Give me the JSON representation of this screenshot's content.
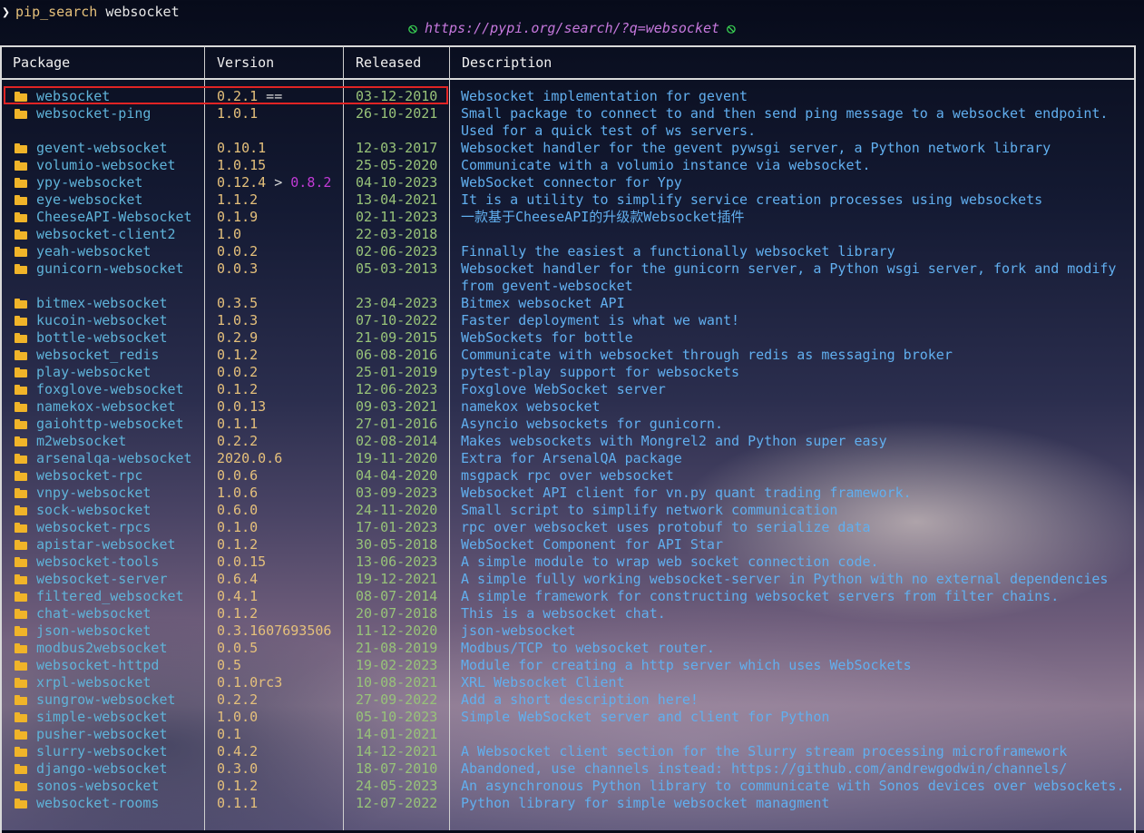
{
  "prompt": {
    "caret": "❯",
    "command": "pip_search",
    "argument": "websocket"
  },
  "url_line": {
    "icon": "⦸",
    "url": "https://pypi.org/search/?q=websocket"
  },
  "columns": [
    "Package",
    "Version",
    "Released",
    "Description"
  ],
  "colors": {
    "package": "#5fb3d9",
    "version": "#e5c07b",
    "date": "#98c379",
    "description": "#61afef",
    "folder_icon": "#f0b429",
    "highlight": "#e02424"
  },
  "rows": [
    {
      "pkg": "websocket",
      "ver": "0.2.1",
      "ver_cmp": " ==",
      "ver_new": "",
      "date": "03-12-2010",
      "desc": "Websocket implementation for gevent"
    },
    {
      "pkg": "websocket-ping",
      "ver": "1.0.1",
      "ver_cmp": "",
      "ver_new": "",
      "date": "26-10-2021",
      "desc": "Small package to connect to and then send ping message to a websocket endpoint."
    },
    {
      "pkg": "",
      "ver": "",
      "ver_cmp": "",
      "ver_new": "",
      "date": "",
      "desc": "Used for a quick test of ws servers."
    },
    {
      "pkg": "gevent-websocket",
      "ver": "0.10.1",
      "ver_cmp": "",
      "ver_new": "",
      "date": "12-03-2017",
      "desc": "Websocket handler for the gevent pywsgi server, a Python network library"
    },
    {
      "pkg": "volumio-websocket",
      "ver": "1.0.15",
      "ver_cmp": "",
      "ver_new": "",
      "date": "25-05-2020",
      "desc": "Communicate with a volumio instance via websocket."
    },
    {
      "pkg": "ypy-websocket",
      "ver": "0.12.4",
      "ver_cmp": " > ",
      "ver_new": "0.8.2",
      "date": "04-10-2023",
      "desc": "WebSocket connector for Ypy"
    },
    {
      "pkg": "eye-websocket",
      "ver": "1.1.2",
      "ver_cmp": "",
      "ver_new": "",
      "date": "13-04-2021",
      "desc": "It is a utility to simplify service creation processes using websockets"
    },
    {
      "pkg": "CheeseAPI-Websocket",
      "ver": "0.1.9",
      "ver_cmp": "",
      "ver_new": "",
      "date": "02-11-2023",
      "desc": "一款基于CheeseAPI的升级款Websocket插件"
    },
    {
      "pkg": "websocket-client2",
      "ver": "1.0",
      "ver_cmp": "",
      "ver_new": "",
      "date": "22-03-2018",
      "desc": ""
    },
    {
      "pkg": "yeah-websocket",
      "ver": "0.0.2",
      "ver_cmp": "",
      "ver_new": "",
      "date": "02-06-2023",
      "desc": "Finnally the easiest a functionally websocket library"
    },
    {
      "pkg": "gunicorn-websocket",
      "ver": "0.0.3",
      "ver_cmp": "",
      "ver_new": "",
      "date": "05-03-2013",
      "desc": "Websocket handler for the gunicorn server, a Python wsgi server, fork and modify"
    },
    {
      "pkg": "",
      "ver": "",
      "ver_cmp": "",
      "ver_new": "",
      "date": "",
      "desc": "from gevent-websocket"
    },
    {
      "pkg": "bitmex-websocket",
      "ver": "0.3.5",
      "ver_cmp": "",
      "ver_new": "",
      "date": "23-04-2023",
      "desc": "Bitmex websocket API"
    },
    {
      "pkg": "kucoin-websocket",
      "ver": "1.0.3",
      "ver_cmp": "",
      "ver_new": "",
      "date": "07-10-2022",
      "desc": "Faster deployment is what we want!"
    },
    {
      "pkg": "bottle-websocket",
      "ver": "0.2.9",
      "ver_cmp": "",
      "ver_new": "",
      "date": "21-09-2015",
      "desc": "WebSockets for bottle"
    },
    {
      "pkg": "websocket_redis",
      "ver": "0.1.2",
      "ver_cmp": "",
      "ver_new": "",
      "date": "06-08-2016",
      "desc": "Communicate with websocket through redis as messaging broker"
    },
    {
      "pkg": "play-websocket",
      "ver": "0.0.2",
      "ver_cmp": "",
      "ver_new": "",
      "date": "25-01-2019",
      "desc": "pytest-play support for websockets"
    },
    {
      "pkg": "foxglove-websocket",
      "ver": "0.1.2",
      "ver_cmp": "",
      "ver_new": "",
      "date": "12-06-2023",
      "desc": "Foxglove WebSocket server"
    },
    {
      "pkg": "namekox-websocket",
      "ver": "0.0.13",
      "ver_cmp": "",
      "ver_new": "",
      "date": "09-03-2021",
      "desc": "namekox websocket"
    },
    {
      "pkg": "gaiohttp-websocket",
      "ver": "0.1.1",
      "ver_cmp": "",
      "ver_new": "",
      "date": "27-01-2016",
      "desc": "Asyncio websockets for gunicorn."
    },
    {
      "pkg": "m2websocket",
      "ver": "0.2.2",
      "ver_cmp": "",
      "ver_new": "",
      "date": "02-08-2014",
      "desc": "Makes websockets with Mongrel2 and Python super easy"
    },
    {
      "pkg": "arsenalqa-websocket",
      "ver": "2020.0.6",
      "ver_cmp": "",
      "ver_new": "",
      "date": "19-11-2020",
      "desc": "Extra for ArsenalQA package"
    },
    {
      "pkg": "websocket-rpc",
      "ver": "0.0.6",
      "ver_cmp": "",
      "ver_new": "",
      "date": "04-04-2020",
      "desc": "msgpack rpc over websocket"
    },
    {
      "pkg": "vnpy-websocket",
      "ver": "1.0.6",
      "ver_cmp": "",
      "ver_new": "",
      "date": "03-09-2023",
      "desc": "Websocket API client for vn.py quant trading framework."
    },
    {
      "pkg": "sock-websocket",
      "ver": "0.6.0",
      "ver_cmp": "",
      "ver_new": "",
      "date": "24-11-2020",
      "desc": "Small script to simplify network communication"
    },
    {
      "pkg": "websocket-rpcs",
      "ver": "0.1.0",
      "ver_cmp": "",
      "ver_new": "",
      "date": "17-01-2023",
      "desc": "rpc over websocket uses protobuf to serialize data"
    },
    {
      "pkg": "apistar-websocket",
      "ver": "0.1.2",
      "ver_cmp": "",
      "ver_new": "",
      "date": "30-05-2018",
      "desc": "WebSocket Component for API Star"
    },
    {
      "pkg": "websocket-tools",
      "ver": "0.0.15",
      "ver_cmp": "",
      "ver_new": "",
      "date": "13-06-2023",
      "desc": "A simple module to wrap web socket connection code."
    },
    {
      "pkg": "websocket-server",
      "ver": "0.6.4",
      "ver_cmp": "",
      "ver_new": "",
      "date": "19-12-2021",
      "desc": "A simple fully working websocket-server in Python with no external dependencies"
    },
    {
      "pkg": "filtered_websocket",
      "ver": "0.4.1",
      "ver_cmp": "",
      "ver_new": "",
      "date": "08-07-2014",
      "desc": "A simple framework for constructing websocket servers from filter chains."
    },
    {
      "pkg": "chat-websocket",
      "ver": "0.1.2",
      "ver_cmp": "",
      "ver_new": "",
      "date": "20-07-2018",
      "desc": "This is a websocket chat."
    },
    {
      "pkg": "json-websocket",
      "ver": "0.3.1607693506",
      "ver_cmp": "",
      "ver_new": "",
      "date": "11-12-2020",
      "desc": "json-websocket"
    },
    {
      "pkg": "modbus2websocket",
      "ver": "0.0.5",
      "ver_cmp": "",
      "ver_new": "",
      "date": "21-08-2019",
      "desc": "Modbus/TCP to websocket router."
    },
    {
      "pkg": "websocket-httpd",
      "ver": "0.5",
      "ver_cmp": "",
      "ver_new": "",
      "date": "19-02-2023",
      "desc": "Module for creating a http server which uses WebSockets"
    },
    {
      "pkg": "xrpl-websocket",
      "ver": "0.1.0rc3",
      "ver_cmp": "",
      "ver_new": "",
      "date": "10-08-2021",
      "desc": "XRL Websocket Client"
    },
    {
      "pkg": "sungrow-websocket",
      "ver": "0.2.2",
      "ver_cmp": "",
      "ver_new": "",
      "date": "27-09-2022",
      "desc": "Add a short description here!"
    },
    {
      "pkg": "simple-websocket",
      "ver": "1.0.0",
      "ver_cmp": "",
      "ver_new": "",
      "date": "05-10-2023",
      "desc": "Simple WebSocket server and client for Python"
    },
    {
      "pkg": "pusher-websocket",
      "ver": "0.1",
      "ver_cmp": "",
      "ver_new": "",
      "date": "14-01-2021",
      "desc": ""
    },
    {
      "pkg": "slurry-websocket",
      "ver": "0.4.2",
      "ver_cmp": "",
      "ver_new": "",
      "date": "14-12-2021",
      "desc": "A Websocket client section for the Slurry stream processing microframework"
    },
    {
      "pkg": "django-websocket",
      "ver": "0.3.0",
      "ver_cmp": "",
      "ver_new": "",
      "date": "18-07-2010",
      "desc": "Abandoned, use channels instead: https://github.com/andrewgodwin/channels/"
    },
    {
      "pkg": "sonos-websocket",
      "ver": "0.1.2",
      "ver_cmp": "",
      "ver_new": "",
      "date": "24-05-2023",
      "desc": "An asynchronous Python library to communicate with Sonos devices over websockets."
    },
    {
      "pkg": "websocket-rooms",
      "ver": "0.1.1",
      "ver_cmp": "",
      "ver_new": "",
      "date": "12-07-2022",
      "desc": "Python library for simple websocket managment"
    },
    {
      "pkg": "",
      "ver": "",
      "ver_cmp": "",
      "ver_new": "",
      "date": "",
      "desc": ""
    }
  ]
}
